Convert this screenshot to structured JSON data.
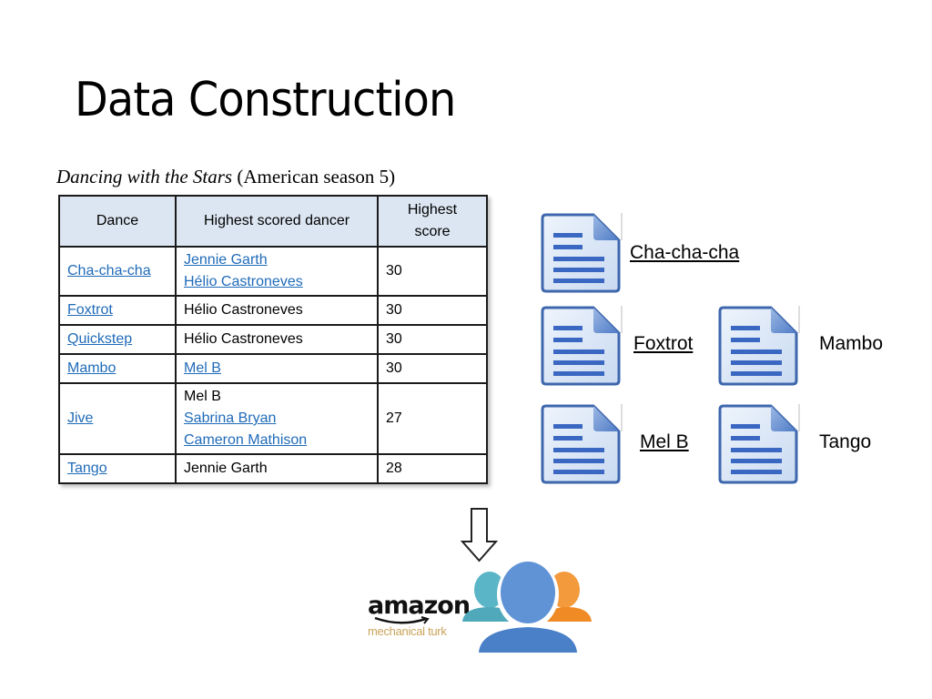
{
  "slide": {
    "title": "Data Construction",
    "caption_italic": "Dancing with the Stars",
    "caption_rest": " (American season 5)"
  },
  "table": {
    "headers": [
      "Dance",
      "Highest scored dancer",
      "Highest score"
    ],
    "header_score_lines": [
      "Highest",
      "score"
    ],
    "rows": [
      {
        "dance": "Cha-cha-cha",
        "dance_link": true,
        "dancers": [
          {
            "name": "Jennie Garth",
            "link": true
          },
          {
            "name": "Hélio Castroneves",
            "link": true
          }
        ],
        "score": "30"
      },
      {
        "dance": "Foxtrot",
        "dance_link": true,
        "dancers": [
          {
            "name": "Hélio Castroneves",
            "link": false
          }
        ],
        "score": "30"
      },
      {
        "dance": "Quickstep",
        "dance_link": true,
        "dancers": [
          {
            "name": "Hélio Castroneves",
            "link": false
          }
        ],
        "score": "30"
      },
      {
        "dance": "Mambo",
        "dance_link": true,
        "dancers": [
          {
            "name": "Mel B",
            "link": true
          }
        ],
        "score": "30"
      },
      {
        "dance": "Jive",
        "dance_link": true,
        "dancers": [
          {
            "name": "Mel B",
            "link": false
          },
          {
            "name": "Sabrina Bryan",
            "link": true
          },
          {
            "name": "Cameron Mathison",
            "link": true
          }
        ],
        "score": "27"
      },
      {
        "dance": "Tango",
        "dance_link": true,
        "dancers": [
          {
            "name": "Jennie Garth",
            "link": false
          }
        ],
        "score": "28"
      }
    ]
  },
  "documents": [
    {
      "label": "Cha-cha-cha",
      "underlined": true,
      "icon": "document-icon"
    },
    {
      "label": "Foxtrot",
      "underlined": true,
      "icon": "document-icon"
    },
    {
      "label": "Mambo",
      "underlined": false,
      "icon": "document-icon"
    },
    {
      "label": "Mel B",
      "underlined": true,
      "icon": "document-icon"
    },
    {
      "label": "Tango",
      "underlined": false,
      "icon": "document-icon"
    }
  ],
  "crowd": {
    "arrow_icon": "down-arrow-icon",
    "logo_word": "amazon",
    "logo_sub": "mechanical turk",
    "people_icon": "crowd-people-icon"
  },
  "colors": {
    "link": "#1f6bb8",
    "table_header_bg": "#dce6f2",
    "doc_blue": "#3d6cc0",
    "person_teal": "#4fb3c4",
    "person_blue": "#4f86cf",
    "person_orange": "#f08a2a"
  }
}
